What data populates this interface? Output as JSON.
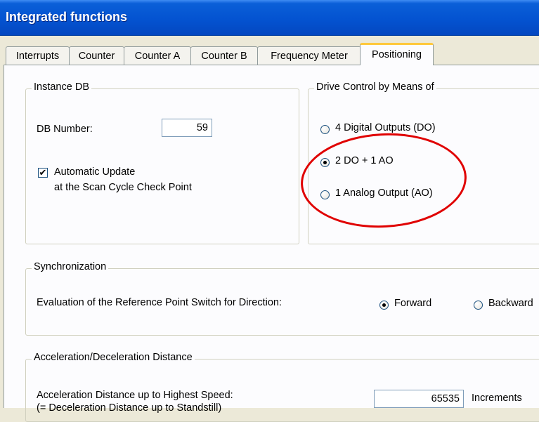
{
  "window": {
    "title": "Integrated functions"
  },
  "tabs": [
    {
      "label": "Interrupts",
      "active": false
    },
    {
      "label": "Counter",
      "active": false
    },
    {
      "label": "Counter A",
      "active": false
    },
    {
      "label": "Counter B",
      "active": false
    },
    {
      "label": "Frequency Meter",
      "active": false
    },
    {
      "label": "Positioning",
      "active": true
    }
  ],
  "instance_db": {
    "legend": "Instance DB",
    "db_number_label": "DB Number:",
    "db_number_value": "59",
    "auto_update_checked": true,
    "auto_update_line1": "Automatic Update",
    "auto_update_line2": "at the Scan Cycle Check Point"
  },
  "drive_control": {
    "legend": "Drive Control by Means of",
    "options": [
      {
        "label": "4 Digital Outputs (DO)",
        "checked": false
      },
      {
        "label": "2 DO + 1 AO",
        "checked": true
      },
      {
        "label": "1 Analog Output (AO)",
        "checked": false
      }
    ]
  },
  "synchronization": {
    "legend": "Synchronization",
    "evaluation_label": "Evaluation of the Reference Point Switch for Direction:",
    "forward_label": "Forward",
    "forward_checked": true,
    "backward_label": "Backward",
    "backward_checked": false
  },
  "accel_decel": {
    "legend": "Acceleration/Deceleration Distance",
    "distance_label_line1": "Acceleration Distance up to Highest Speed:",
    "distance_label_line2": "(= Deceleration Distance up to Standstill)",
    "distance_value": "65535",
    "unit": "Increments"
  },
  "colors": {
    "title_bar": "#0453d1",
    "annotation_circle": "#e00000",
    "tab_highlight": "#ffc83c"
  }
}
